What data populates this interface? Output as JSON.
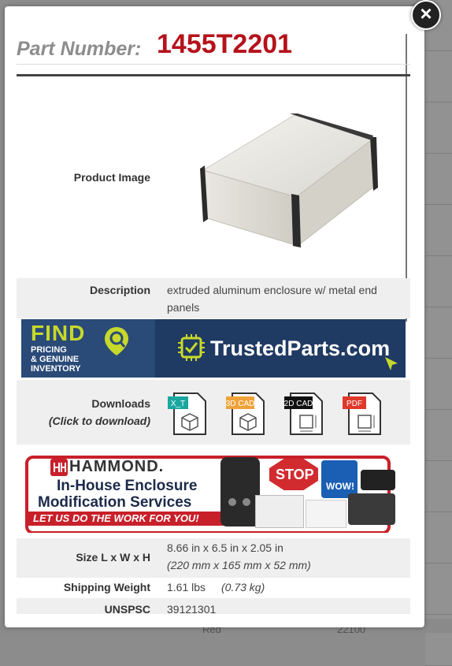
{
  "part": {
    "label": "Part Number:",
    "number": "1455T2201"
  },
  "product_image": {
    "label": "Product Image"
  },
  "description": {
    "label": "Description",
    "value": "extruded aluminum enclosure w/ metal end panels"
  },
  "trustedparts_banner": {
    "find": "FIND",
    "sub": [
      "PRICING",
      "& GENUINE",
      "INVENTORY"
    ],
    "name": "TrustedParts.com"
  },
  "downloads": {
    "label": "Downloads",
    "sublabel": "(Click to download)",
    "files": [
      {
        "tag": "X_T",
        "color": "#1aa7a0"
      },
      {
        "tag": "3D CAD",
        "color": "#f0a23a"
      },
      {
        "tag": "2D CAD",
        "color": "#111111"
      },
      {
        "tag": "PDF",
        "color": "#e0392b"
      }
    ]
  },
  "hammond_banner": {
    "logo": "HAMMOND.",
    "line1": "In-House Enclosure",
    "line2": "Modification Services",
    "tagline": "LET US DO THE WORK FOR YOU!",
    "stop": "STOP",
    "wow": "WOW!"
  },
  "size": {
    "label": "Size L x W x H",
    "imperial": "8.66 in x 6.5 in x 2.05 in",
    "metric": "(220 mm x 165 mm x 52 mm)"
  },
  "weight": {
    "label": "Shipping Weight",
    "imperial": "1.61 lbs",
    "metric": "(0.73 kg)"
  },
  "unspsc": {
    "label": "UNSPSC",
    "value": "39121301"
  },
  "background_row": {
    "color": "Red",
    "num": "22100"
  },
  "close": {
    "glyph": "×"
  }
}
